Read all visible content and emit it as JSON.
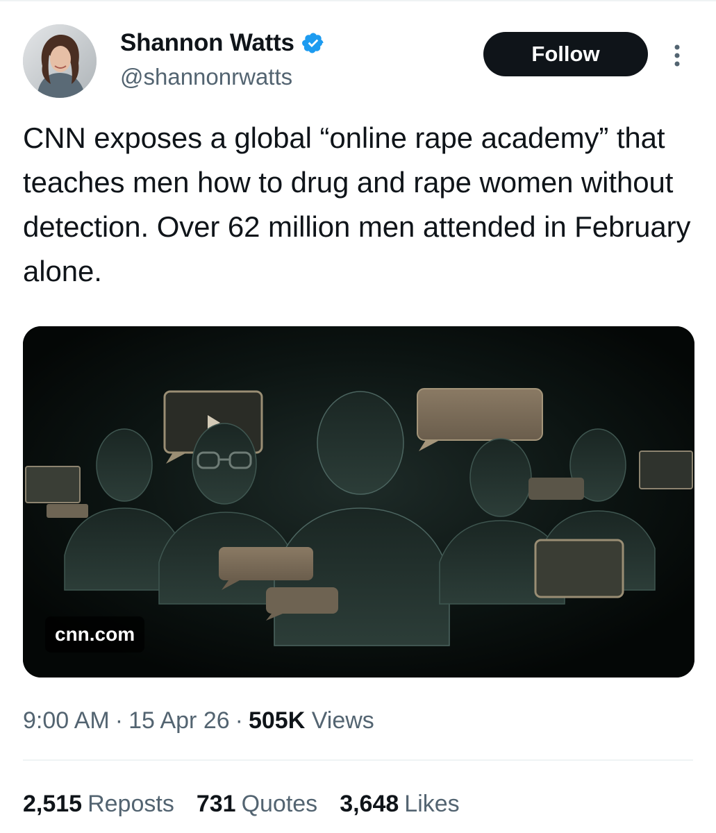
{
  "author": {
    "name": "Shannon Watts",
    "handle": "@shannonrwatts",
    "verified_color": "#1d9bf0"
  },
  "follow_label": "Follow",
  "tweet_text": "CNN exposes a global “online rape academy” that teaches men how to drug and rape women without detection. Over 62 million men attended in February alone.",
  "media": {
    "source": "cnn.com"
  },
  "meta": {
    "time": "9:00 AM",
    "separator": "·",
    "date": "15 Apr 26",
    "views_count": "505K",
    "views_label": "Views"
  },
  "stats": {
    "reposts_count": "2,515",
    "reposts_label": "Reposts",
    "quotes_count": "731",
    "quotes_label": "Quotes",
    "likes_count": "3,648",
    "likes_label": "Likes"
  }
}
